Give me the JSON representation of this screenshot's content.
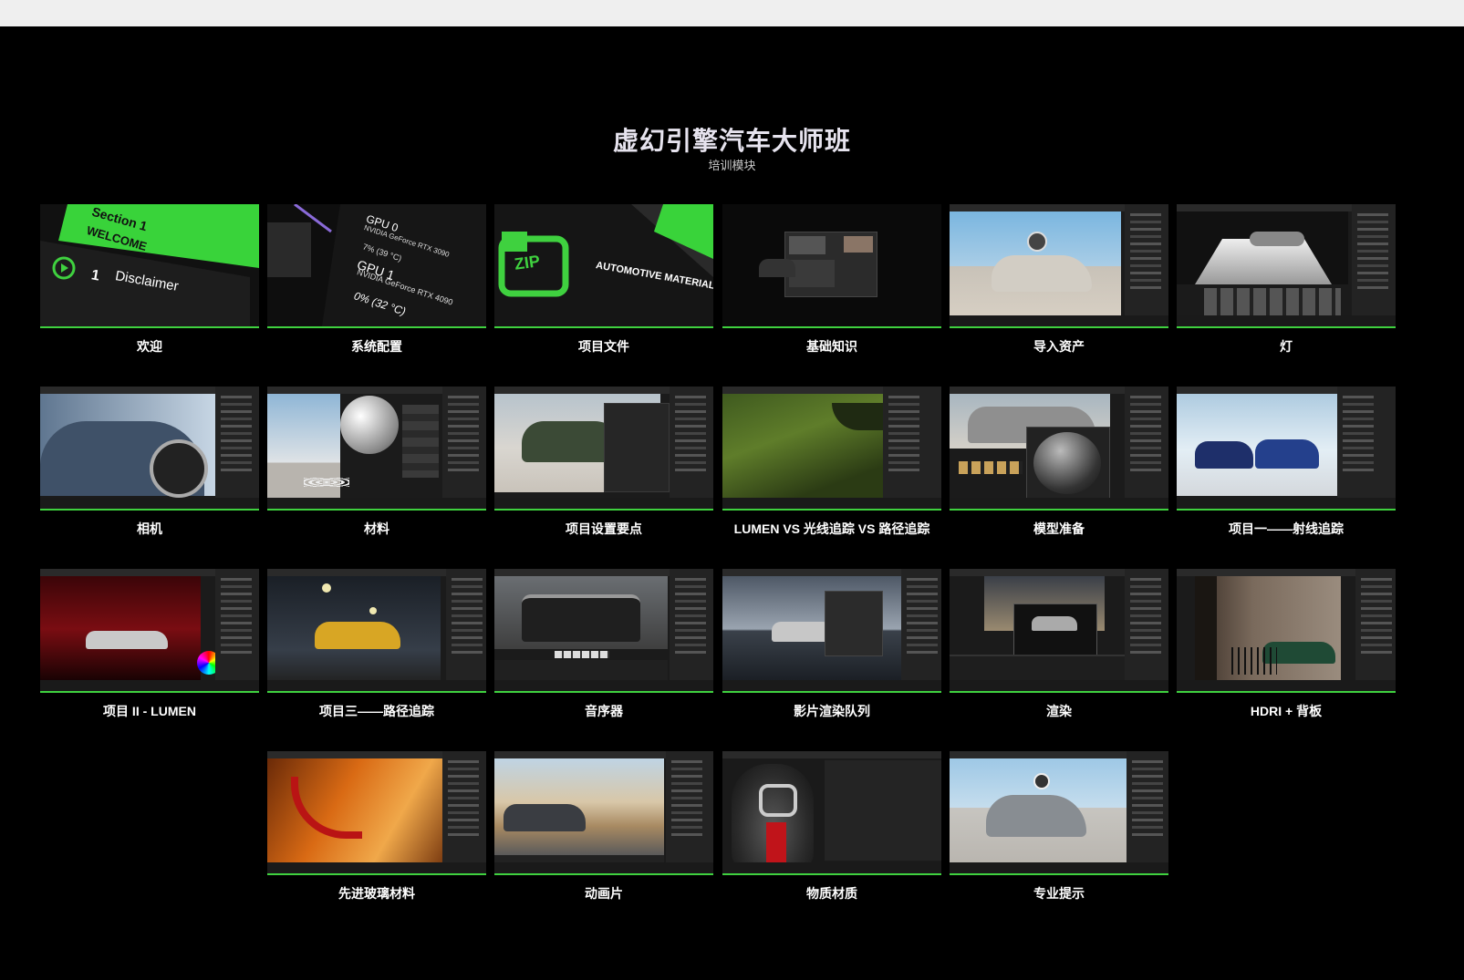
{
  "header": {
    "title": "虚幻引擎汽车大师班",
    "subtitle": "培训模块"
  },
  "modules": [
    {
      "label": "欢迎"
    },
    {
      "label": "系统配置"
    },
    {
      "label": "项目文件"
    },
    {
      "label": "基础知识"
    },
    {
      "label": "导入资产"
    },
    {
      "label": "灯"
    },
    {
      "label": "相机"
    },
    {
      "label": "材料"
    },
    {
      "label": "项目设置要点"
    },
    {
      "label": "LUMEN VS 光线追踪 VS 路径追踪"
    },
    {
      "label": "模型准备"
    },
    {
      "label": "项目一——射线追踪"
    },
    {
      "label": "项目 II - LUMEN"
    },
    {
      "label": "项目三——路径追踪"
    },
    {
      "label": "音序器"
    },
    {
      "label": "影片渲染队列"
    },
    {
      "label": "渲染"
    },
    {
      "label": "HDRI + 背板"
    },
    {
      "label": "先进玻璃材料"
    },
    {
      "label": "动画片"
    },
    {
      "label": "物质材质"
    },
    {
      "label": "专业提示"
    }
  ],
  "thumb_text": {
    "welcome_section": "Section 1",
    "welcome_heading": "WELCOME",
    "welcome_number": "1",
    "welcome_item": "Disclaimer",
    "sys_gpu0": "GPU 0",
    "sys_gpu0_name": "NVIDIA GeForce RTX 3090",
    "sys_gpu0_load": "7% (39 °C)",
    "sys_gpu1": "GPU 1",
    "sys_gpu1_name": "NVIDIA GeForce RTX 4090",
    "sys_gpu1_load": "0% (32 °C)",
    "zip_label": "ZIP",
    "zip_pack": "AUTOMOTIVE MATERIALS PACK"
  },
  "colors": {
    "accent_green": "#3fd13f",
    "background": "#000000"
  }
}
